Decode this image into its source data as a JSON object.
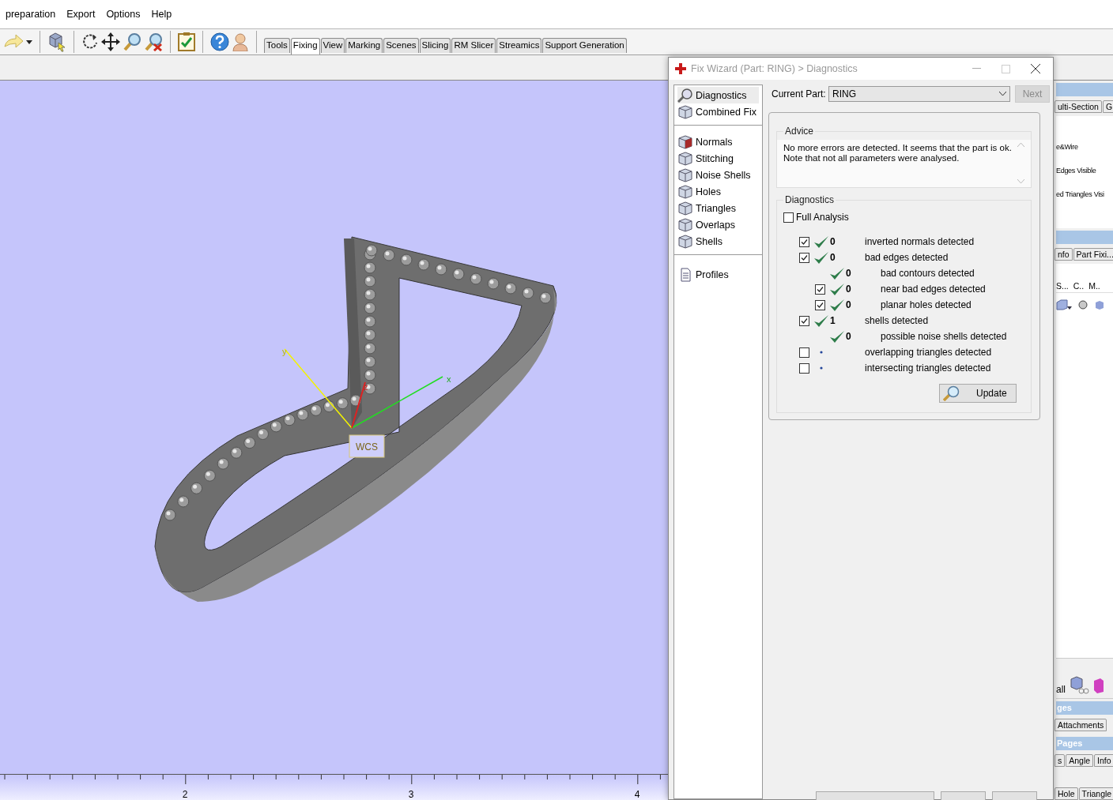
{
  "menu": [
    {
      "label": "preparation"
    },
    {
      "label": "Export"
    },
    {
      "label": "Options"
    },
    {
      "label": "Help"
    }
  ],
  "toolbar_tabs": [
    {
      "label": "Tools",
      "selected": false
    },
    {
      "label": "Fixing",
      "selected": true
    },
    {
      "label": "View",
      "selected": false
    },
    {
      "label": "Marking",
      "selected": false
    },
    {
      "label": "Scenes",
      "selected": false
    },
    {
      "label": "Slicing",
      "selected": false
    },
    {
      "label": "RM Slicer",
      "selected": false
    },
    {
      "label": "Streamics",
      "selected": false
    },
    {
      "label": "Support Generation",
      "selected": false
    }
  ],
  "viewport": {
    "axis_labels": [
      "x",
      "y",
      "z"
    ],
    "origin_label": "WCS",
    "ruler_labels": [
      "2",
      "3",
      "4"
    ]
  },
  "side_panel": [
    {
      "kind": "header"
    },
    {
      "kind": "tabs",
      "tabs": [
        "ulti-Section",
        "G"
      ]
    },
    {
      "kind": "options",
      "texts": [
        "e&Wire",
        "Edges Visible",
        "ed Triangles Visi"
      ]
    },
    {
      "kind": "header"
    },
    {
      "kind": "tabs",
      "tabs": [
        "nfo",
        "Part Fixi..."
      ]
    },
    {
      "kind": "columns",
      "texts": [
        "S...",
        "C..",
        "M.."
      ]
    },
    {
      "kind": "toolbar",
      "texts": [
        "all"
      ]
    },
    {
      "kind": "header",
      "text": "ges"
    },
    {
      "kind": "tabs",
      "tabs": [
        "Attachments"
      ]
    },
    {
      "kind": "header",
      "text": "Pages"
    },
    {
      "kind": "tabs",
      "tabs": [
        "s",
        "Angle",
        "Info"
      ]
    },
    {
      "kind": "tabs",
      "tabs": [
        "Hole",
        "Triangle"
      ]
    }
  ],
  "fix_wizard": {
    "title": "Fix Wizard (Part: RING) > Diagnostics",
    "nav_groups": [
      {
        "items": [
          {
            "label": "Diagnostics",
            "selected": true
          },
          {
            "label": "Combined Fix",
            "selected": false
          }
        ]
      },
      {
        "items": [
          {
            "label": "Normals",
            "selected": false
          },
          {
            "label": "Stitching",
            "selected": false
          },
          {
            "label": "Noise Shells",
            "selected": false
          },
          {
            "label": "Holes",
            "selected": false
          },
          {
            "label": "Triangles",
            "selected": false
          },
          {
            "label": "Overlaps",
            "selected": false
          },
          {
            "label": "Shells",
            "selected": false
          }
        ]
      },
      {
        "items": [
          {
            "label": "Profiles",
            "selected": false
          }
        ]
      }
    ],
    "current_part_label": "Current Part:",
    "current_part": "RING",
    "next_button": {
      "label": "Next",
      "disabled": true
    },
    "advice": {
      "title": "Advice",
      "text": "No more errors are detected. It seems that the part is ok.\nNote that not all parameters were analysed."
    },
    "diagnostics": {
      "title": "Diagnostics",
      "full_analysis": {
        "label": "Full Analysis",
        "checked": false
      },
      "rows": [
        {
          "checked": true,
          "analysed": true,
          "count": "0",
          "label": "inverted normals detected"
        },
        {
          "checked": true,
          "analysed": true,
          "count": "0",
          "label": "bad edges detected",
          "children": [
            {
              "analysed": true,
              "count": "0",
              "label": "bad contours detected"
            },
            {
              "checked": true,
              "analysed": true,
              "count": "0",
              "label": "near bad edges detected"
            },
            {
              "checked": true,
              "analysed": true,
              "count": "0",
              "label": "planar holes detected"
            }
          ]
        },
        {
          "checked": true,
          "analysed": true,
          "count": "1",
          "label": "shells detected",
          "children": [
            {
              "analysed": true,
              "count": "0",
              "label": "possible noise shells detected"
            }
          ]
        },
        {
          "checked": false,
          "analysed": false,
          "label": "overlapping triangles detected"
        },
        {
          "checked": false,
          "analysed": false,
          "label": "intersecting triangles detected"
        }
      ]
    },
    "update_button": "Update"
  }
}
